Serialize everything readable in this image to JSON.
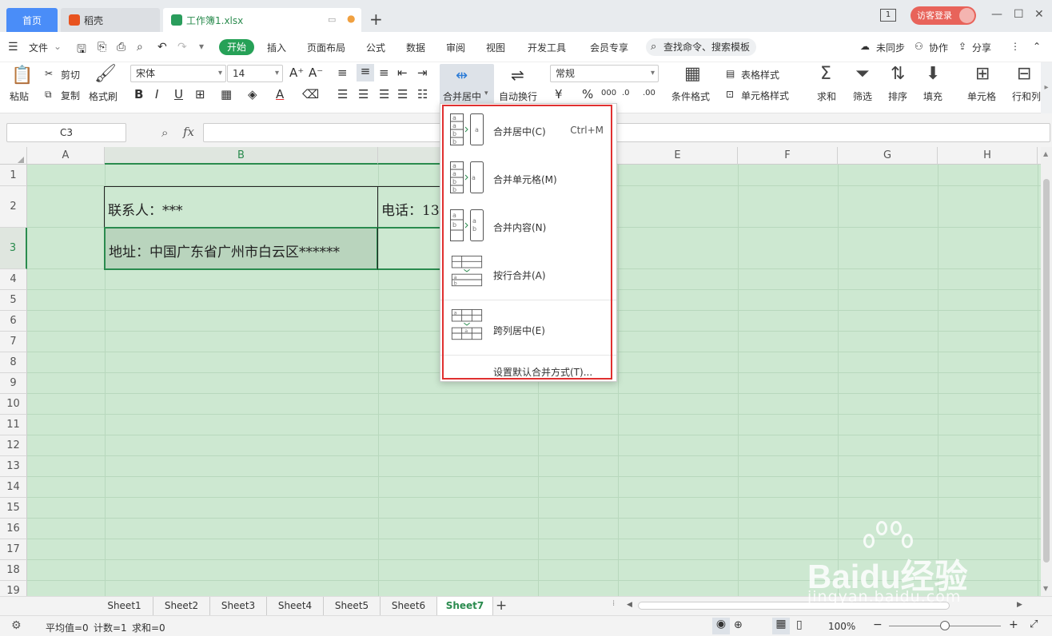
{
  "titlebar": {
    "tab_home": "首页",
    "tab_daoke": "稻壳",
    "tab_book": "工作簿1.xlsx",
    "tab_add": "+",
    "page_badge": "1",
    "guest_login": "访客登录"
  },
  "menubar": {
    "file": "文件",
    "items": [
      "开始",
      "插入",
      "页面布局",
      "公式",
      "数据",
      "审阅",
      "视图",
      "开发工具",
      "会员专享"
    ],
    "search": "查找命令、搜索模板",
    "unsync": "未同步",
    "collab": "协作",
    "share": "分享"
  },
  "ribbon": {
    "paste": "粘贴",
    "cut": "剪切",
    "copy": "复制",
    "format_painter": "格式刷",
    "font_name": "宋体",
    "font_size": "14",
    "merge_center": "合并居中",
    "wrap_text": "自动换行",
    "number_format": "常规",
    "cond_format": "条件格式",
    "table_style": "表格样式",
    "cell_style": "单元格样式",
    "sum": "求和",
    "filter": "筛选",
    "sort": "排序",
    "fill": "填充",
    "cell": "单元格",
    "row_col": "行和列"
  },
  "formula_bar": {
    "name_box": "C3",
    "fx": "fx",
    "value": ""
  },
  "grid": {
    "columns": [
      "A",
      "B",
      "E",
      "F",
      "G",
      "H"
    ],
    "rows": [
      "1",
      "2",
      "3",
      "4",
      "5",
      "6",
      "7",
      "8",
      "9",
      "10",
      "11",
      "12",
      "13",
      "14",
      "15",
      "16",
      "17",
      "18",
      "19"
    ],
    "b2": "联系人：***",
    "c2": "电话：13",
    "b3": "地址：中国广东省广州市白云区******"
  },
  "sheets": {
    "tabs": [
      "Sheet1",
      "Sheet2",
      "Sheet3",
      "Sheet4",
      "Sheet5",
      "Sheet6",
      "Sheet7"
    ],
    "active": "Sheet7"
  },
  "statusbar": {
    "average": "平均值=0",
    "count": "计数=1",
    "sum": "求和=0",
    "zoom": "100%"
  },
  "merge_menu": {
    "items": [
      {
        "label": "合并居中(C)",
        "shortcut": "Ctrl+M"
      },
      {
        "label": "合并单元格(M)",
        "shortcut": ""
      },
      {
        "label": "合并内容(N)",
        "shortcut": ""
      },
      {
        "label": "按行合并(A)",
        "shortcut": ""
      },
      {
        "label": "跨列居中(E)",
        "shortcut": ""
      }
    ],
    "footer": "设置默认合并方式(T)..."
  },
  "watermark": {
    "brand": "Baidu经验",
    "url": "jingyan.baidu.com"
  },
  "colors": {
    "accent_green": "#26a157",
    "sheet_bg": "#cde8d1",
    "highlight_red": "#e03030",
    "tab_blue": "#4a8df8"
  }
}
